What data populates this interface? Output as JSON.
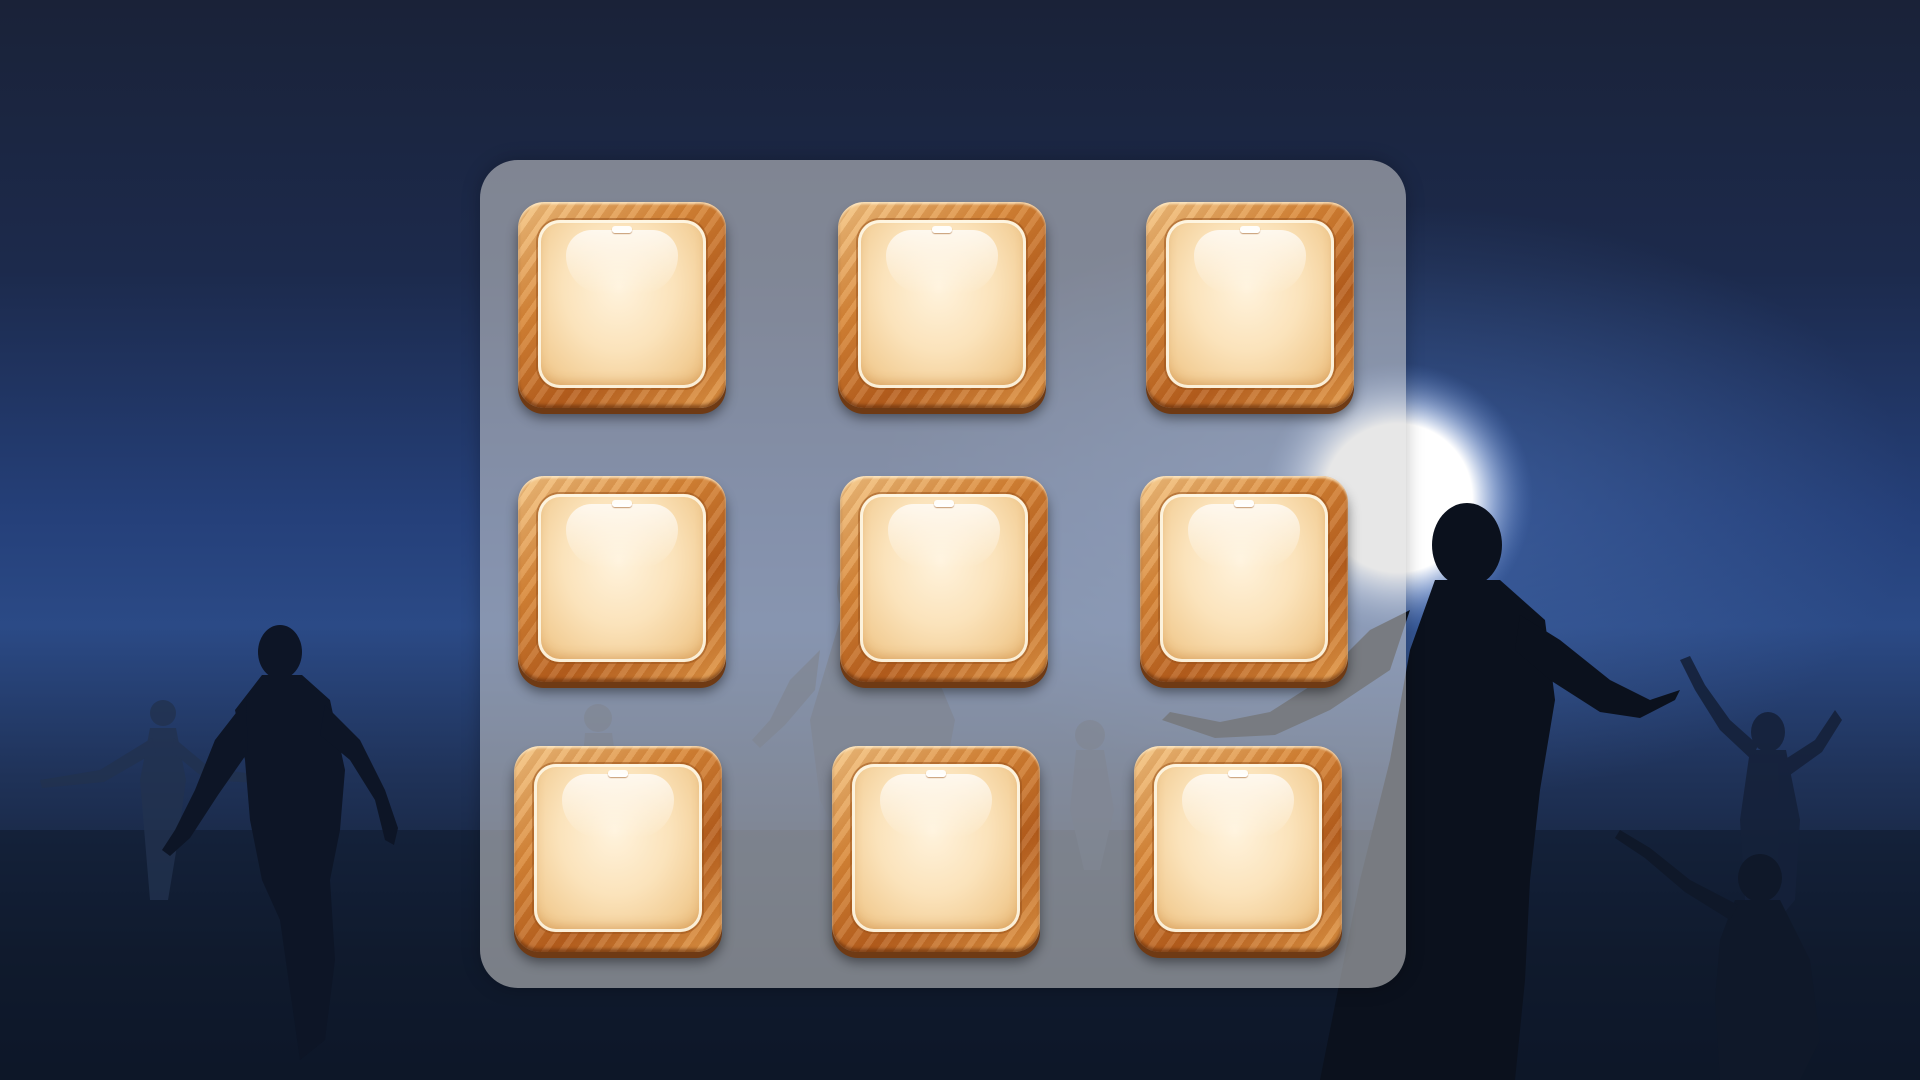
{
  "game": {
    "board": {
      "rows": 3,
      "columns": 3,
      "tiles": [
        {
          "id": "r1c1"
        },
        {
          "id": "r1c2"
        },
        {
          "id": "r1c3"
        },
        {
          "id": "r2c1"
        },
        {
          "id": "r2c2"
        },
        {
          "id": "r2c3"
        },
        {
          "id": "r3c1"
        },
        {
          "id": "r3c2"
        },
        {
          "id": "r3c3"
        }
      ]
    },
    "colors": {
      "sky_top": "#1a2238",
      "sky_horizon": "#2b4a86",
      "moon": "#ffffff",
      "tile_frame": "#d98838",
      "tile_face": "#fbe3bb",
      "panel": "#d4d4d4",
      "silhouette": "#0b111d"
    },
    "icons": [
      "moon-icon",
      "zombie-silhouette"
    ]
  }
}
